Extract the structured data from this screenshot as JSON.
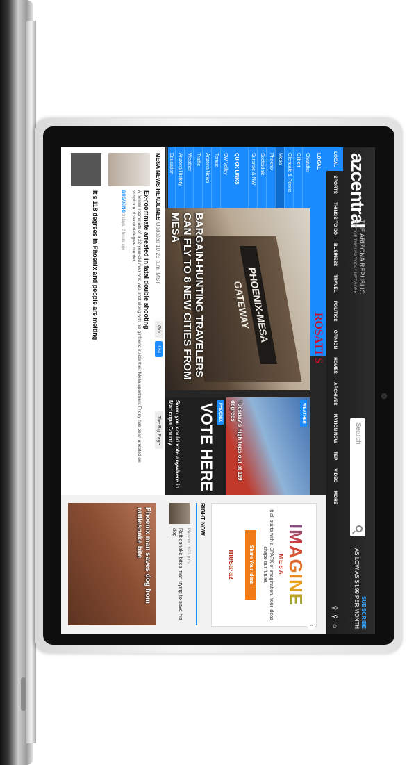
{
  "site": {
    "logo": "azcentral",
    "publisher": "THE ARIZONA REPUBLIC",
    "publisher_sub": "PART OF THE USA TODAY NETWORK",
    "search_placeholder": "Search",
    "subscribe_label": "SUBSCRIBE",
    "subscribe_price": "AS LOW AS $4.99 PER MONTH"
  },
  "nav": {
    "items": [
      "LOCAL",
      "SPORTS",
      "THINGS TO DO",
      "BUSINESS",
      "TRAVEL",
      "POLITICS",
      "OPINION",
      "HOMES",
      "ARCHIVES",
      "NATION NOW",
      "TEP",
      "VIDEO",
      "MORE"
    ],
    "icons": [
      "share-icon",
      "search-icon",
      "user-icon"
    ]
  },
  "local_menu": {
    "title": "LOCAL",
    "items": [
      "Chandler",
      "Gilbert",
      "Glendale & Peoria",
      "Mesa",
      "Phoenix",
      "Scottsdale",
      "Surprise & NW",
      "SW Valley",
      "Tempe"
    ],
    "active": "Mesa"
  },
  "quick_links": {
    "title": "QUICK LINKS",
    "items": [
      "Arizona News",
      "Traffic",
      "Weather",
      "Arizona History",
      "Education"
    ]
  },
  "hero": {
    "sign_text": "PHOENIX-MESA GATEWAY",
    "headline": "BARGAIN-HUNTING TRAVELERS CAN FLY TO 8 NEW CITIES FROM MESA"
  },
  "ad_banner": "ROSATI'S",
  "tiles": {
    "weather_tag": "WEATHER",
    "weather_caption": "Tuesday's high tops out at 119 degrees",
    "vote_tag": "PHOENIX",
    "vote_caption": "Soon you could vote anywhere in Maricopa County",
    "vote_sign": "VOTE HERE"
  },
  "news": {
    "heading": "MESA NEWS HEADLINES",
    "updated": "Updated 10:23 p.m. MST",
    "toggle_grid": "Grid",
    "toggle_list": "List",
    "big_page": "The Big Page",
    "story1_title": "Ex-roommate arrested in fatal double shooting",
    "story1_body": "A former roommate of a 22-year-old man who was shot along with his girlfriend inside their Mesa apartment Friday has been arrested on suspicion of second-degree murder.",
    "story1_breaking": "BREAKING",
    "story1_meta": "3 days, 2 hours ago",
    "story2_title": "It's 118 degrees in Phoenix and people are melting"
  },
  "rail": {
    "ad_title": "IMAGINE",
    "ad_sub": "MESA",
    "ad_copy": "It all starts with a SPARK of imagination. Your ideas shape our future.",
    "ad_button": "Share Your Ideas",
    "ad_brand": "mesa·az",
    "right_now": "RIGHT NOW",
    "right_now_meta": "Phoenix | 6:23 p.m.",
    "right_now_title": "Rattlesnake bites man trying to save his dog",
    "photo_caption": "Phoenix man saves dog from rattlesnake bite"
  }
}
